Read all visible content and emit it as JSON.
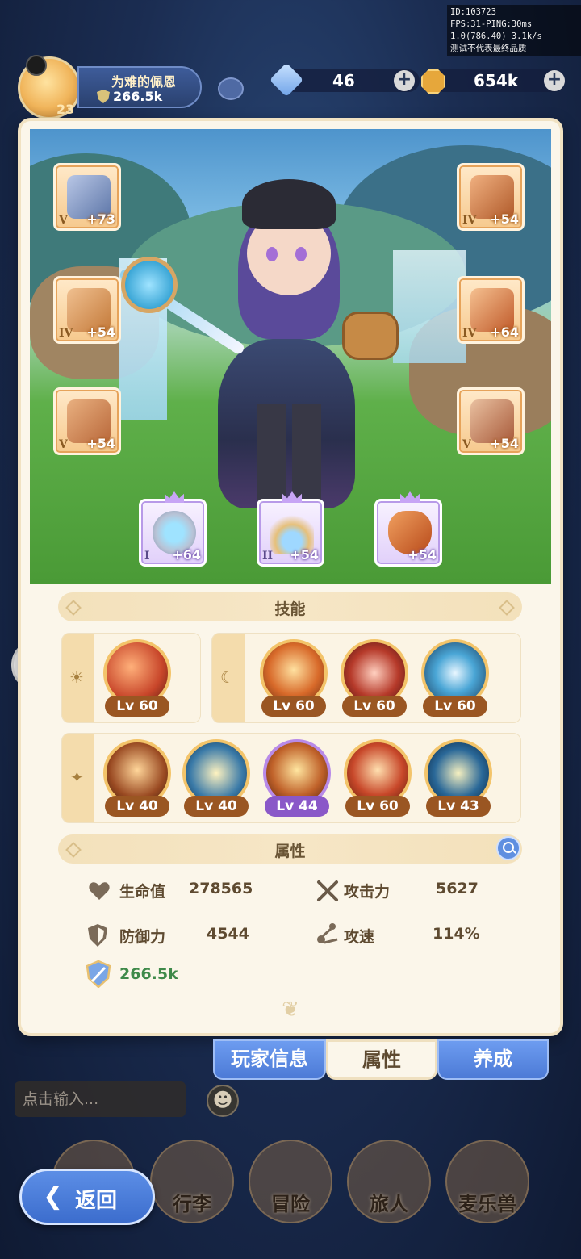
{
  "debug": {
    "id": "ID:103723",
    "fps": "FPS:31-PING:30ms",
    "net": "1.0(786.40)  3.1k/s",
    "note": "测试不代表最终品质"
  },
  "player": {
    "name": "为难的佩恩",
    "power": "266.5k",
    "level": "23"
  },
  "resources": {
    "gems": "46",
    "coins": "654k"
  },
  "equipment": {
    "left": [
      {
        "icon": "halberd-icon",
        "tier": "V",
        "level": "+73"
      },
      {
        "icon": "armor-icon",
        "tier": "IV",
        "level": "+54"
      },
      {
        "icon": "belt-icon",
        "tier": "V",
        "level": "+54"
      }
    ],
    "right": [
      {
        "icon": "helmet-icon",
        "tier": "IV",
        "level": "+54"
      },
      {
        "icon": "gauntlet-icon",
        "tier": "IV",
        "level": "+64"
      },
      {
        "icon": "boots-icon",
        "tier": "V",
        "level": "+54"
      }
    ],
    "accessories": [
      {
        "icon": "ring-icon",
        "tier": "I",
        "level": "+64"
      },
      {
        "icon": "necklace-icon",
        "tier": "II",
        "level": "+54"
      },
      {
        "icon": "amulet-icon",
        "tier": "",
        "level": "+54"
      }
    ]
  },
  "skills": {
    "title": "技能",
    "group_sun": [
      {
        "level": "Lv 60",
        "color": "#c8462a"
      }
    ],
    "group_moon": [
      {
        "level": "Lv 60",
        "color": "#d86a2a"
      },
      {
        "level": "Lv 60",
        "color": "#b63a2a"
      },
      {
        "level": "Lv 60",
        "color": "#2a6e9a"
      }
    ],
    "group_star": [
      {
        "level": "Lv 40",
        "color": "#9a4a22"
      },
      {
        "level": "Lv 40",
        "color": "#3a7aa8"
      },
      {
        "level": "Lv 44",
        "color": "#c0622a",
        "purple": true
      },
      {
        "level": "Lv 60",
        "color": "#c8482a"
      },
      {
        "level": "Lv 43",
        "color": "#2a6898"
      }
    ]
  },
  "attributes": {
    "title": "属性",
    "hp_label": "生命值",
    "hp_value": "278565",
    "atk_label": "攻击力",
    "atk_value": "5627",
    "def_label": "防御力",
    "def_value": "4544",
    "spd_label": "攻速",
    "spd_value": "114%",
    "power_value": "266.5k"
  },
  "tabs": {
    "player_info": "玩家信息",
    "attributes": "属性",
    "develop": "养成"
  },
  "chat": {
    "placeholder": "点击输入..."
  },
  "nav": {
    "back": "返回",
    "bag": "行李",
    "adventure": "冒险",
    "traveler": "旅人",
    "beast": "麦乐兽"
  }
}
